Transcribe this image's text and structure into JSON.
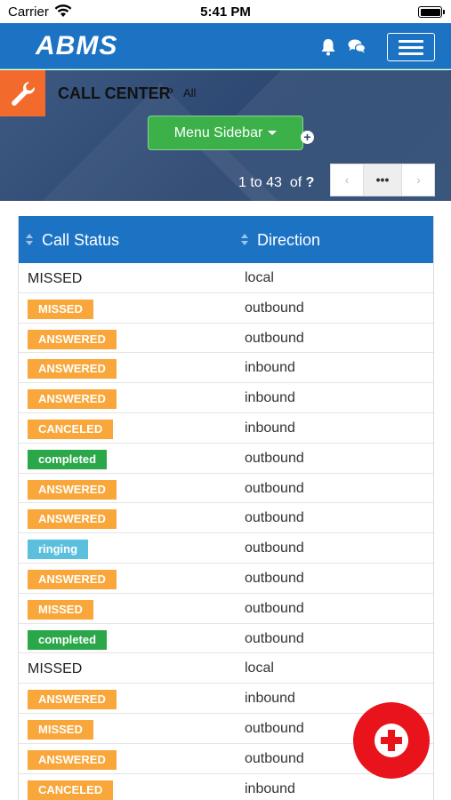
{
  "status_bar": {
    "carrier": "Carrier",
    "time": "5:41 PM"
  },
  "navbar": {
    "logo": "ABMS",
    "icons": [
      "bell-icon",
      "chat-icon",
      "hamburger-icon"
    ]
  },
  "breadcrumb": {
    "title": "CALL CENTER",
    "separator": "›",
    "sub": "All"
  },
  "menu_button": {
    "label": "Menu Sidebar",
    "badge": "+"
  },
  "pager": {
    "range": "1 to 43",
    "of": "of",
    "total": "?",
    "more": "•••",
    "prev": "‹",
    "next": "›"
  },
  "table": {
    "headers": [
      "Call Status",
      "Direction"
    ],
    "rows": [
      {
        "status": "MISSED",
        "style": "plain",
        "direction": "local"
      },
      {
        "status": "MISSED",
        "style": "warning",
        "direction": "outbound"
      },
      {
        "status": "ANSWERED",
        "style": "warning",
        "direction": "outbound"
      },
      {
        "status": "ANSWERED",
        "style": "warning",
        "direction": "inbound"
      },
      {
        "status": "ANSWERED",
        "style": "warning",
        "direction": "inbound"
      },
      {
        "status": "CANCELED",
        "style": "warning",
        "direction": "inbound"
      },
      {
        "status": "completed",
        "style": "success",
        "direction": "outbound"
      },
      {
        "status": "ANSWERED",
        "style": "warning",
        "direction": "outbound"
      },
      {
        "status": "ANSWERED",
        "style": "warning",
        "direction": "outbound"
      },
      {
        "status": "ringing",
        "style": "info",
        "direction": "outbound"
      },
      {
        "status": "ANSWERED",
        "style": "warning",
        "direction": "outbound"
      },
      {
        "status": "MISSED",
        "style": "warning",
        "direction": "outbound"
      },
      {
        "status": "completed",
        "style": "success",
        "direction": "outbound"
      },
      {
        "status": "MISSED",
        "style": "plain",
        "direction": "local"
      },
      {
        "status": "ANSWERED",
        "style": "warning",
        "direction": "inbound"
      },
      {
        "status": "MISSED",
        "style": "warning",
        "direction": "outbound"
      },
      {
        "status": "ANSWERED",
        "style": "warning",
        "direction": "outbound"
      },
      {
        "status": "CANCELED",
        "style": "warning",
        "direction": "inbound"
      }
    ]
  },
  "colors": {
    "primary": "#1c73c4",
    "warning": "#f9a63a",
    "success": "#2aa849",
    "info": "#5bc0de",
    "accent": "#f26b2d",
    "fab": "#e8131b"
  },
  "fab": {
    "icon": "plus-circle-icon"
  }
}
